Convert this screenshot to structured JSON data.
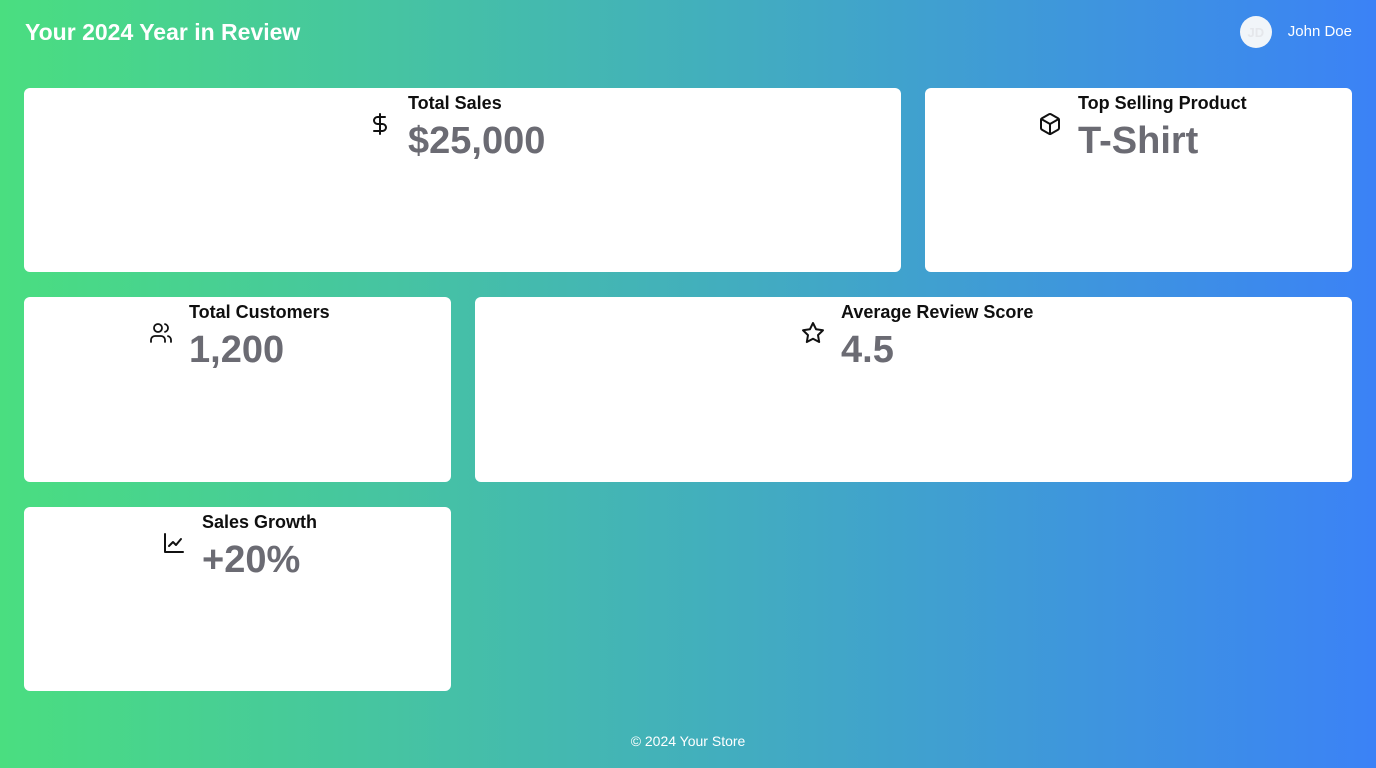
{
  "header": {
    "title": "Your 2024 Year in Review",
    "user": {
      "initials": "JD",
      "name": "John Doe"
    }
  },
  "cards": [
    {
      "label": "Total Sales",
      "value": "$25,000",
      "icon": "dollar-icon"
    },
    {
      "label": "Top Selling Product",
      "value": "T-Shirt",
      "icon": "package-icon"
    },
    {
      "label": "Total Customers",
      "value": "1,200",
      "icon": "users-icon"
    },
    {
      "label": "Average Review Score",
      "value": "4.5",
      "icon": "star-icon"
    },
    {
      "label": "Sales Growth",
      "value": "+20%",
      "icon": "chart-line-icon"
    }
  ],
  "footer": {
    "text": "© 2024 Your Store"
  },
  "colors": {
    "gradient_start": "#4ade80",
    "gradient_end": "#3b82f6",
    "card_bg": "#ffffff",
    "value_text": "#6b6b73"
  }
}
